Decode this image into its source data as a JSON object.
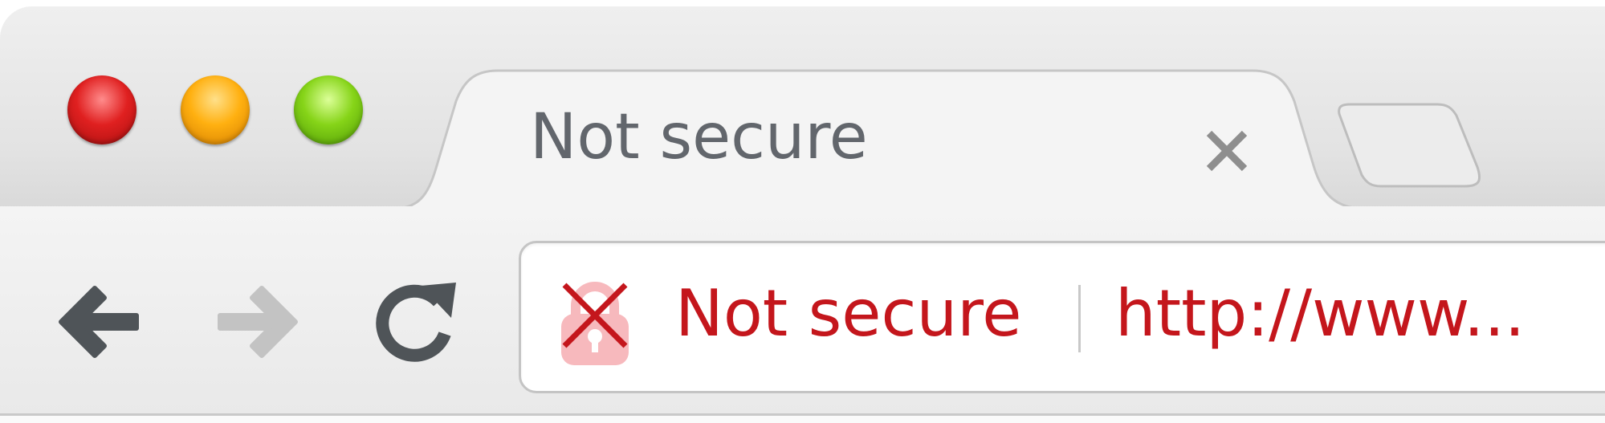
{
  "tab": {
    "title": "Not secure",
    "close_symbol": "×"
  },
  "toolbar": {
    "back_icon": "arrow-left-icon",
    "forward_icon": "arrow-right-icon",
    "reload_icon": "reload-icon"
  },
  "omnibox": {
    "security_icon": "broken-lock-icon",
    "security_label": "Not secure",
    "url": "http://www..."
  },
  "colors": {
    "insecure_red": "#c4161c",
    "lock_pink": "#f7b9bd",
    "close_red": "#e02020",
    "minimize_yellow": "#ffb010",
    "zoom_green": "#86d418",
    "tab_text": "#62666c"
  }
}
